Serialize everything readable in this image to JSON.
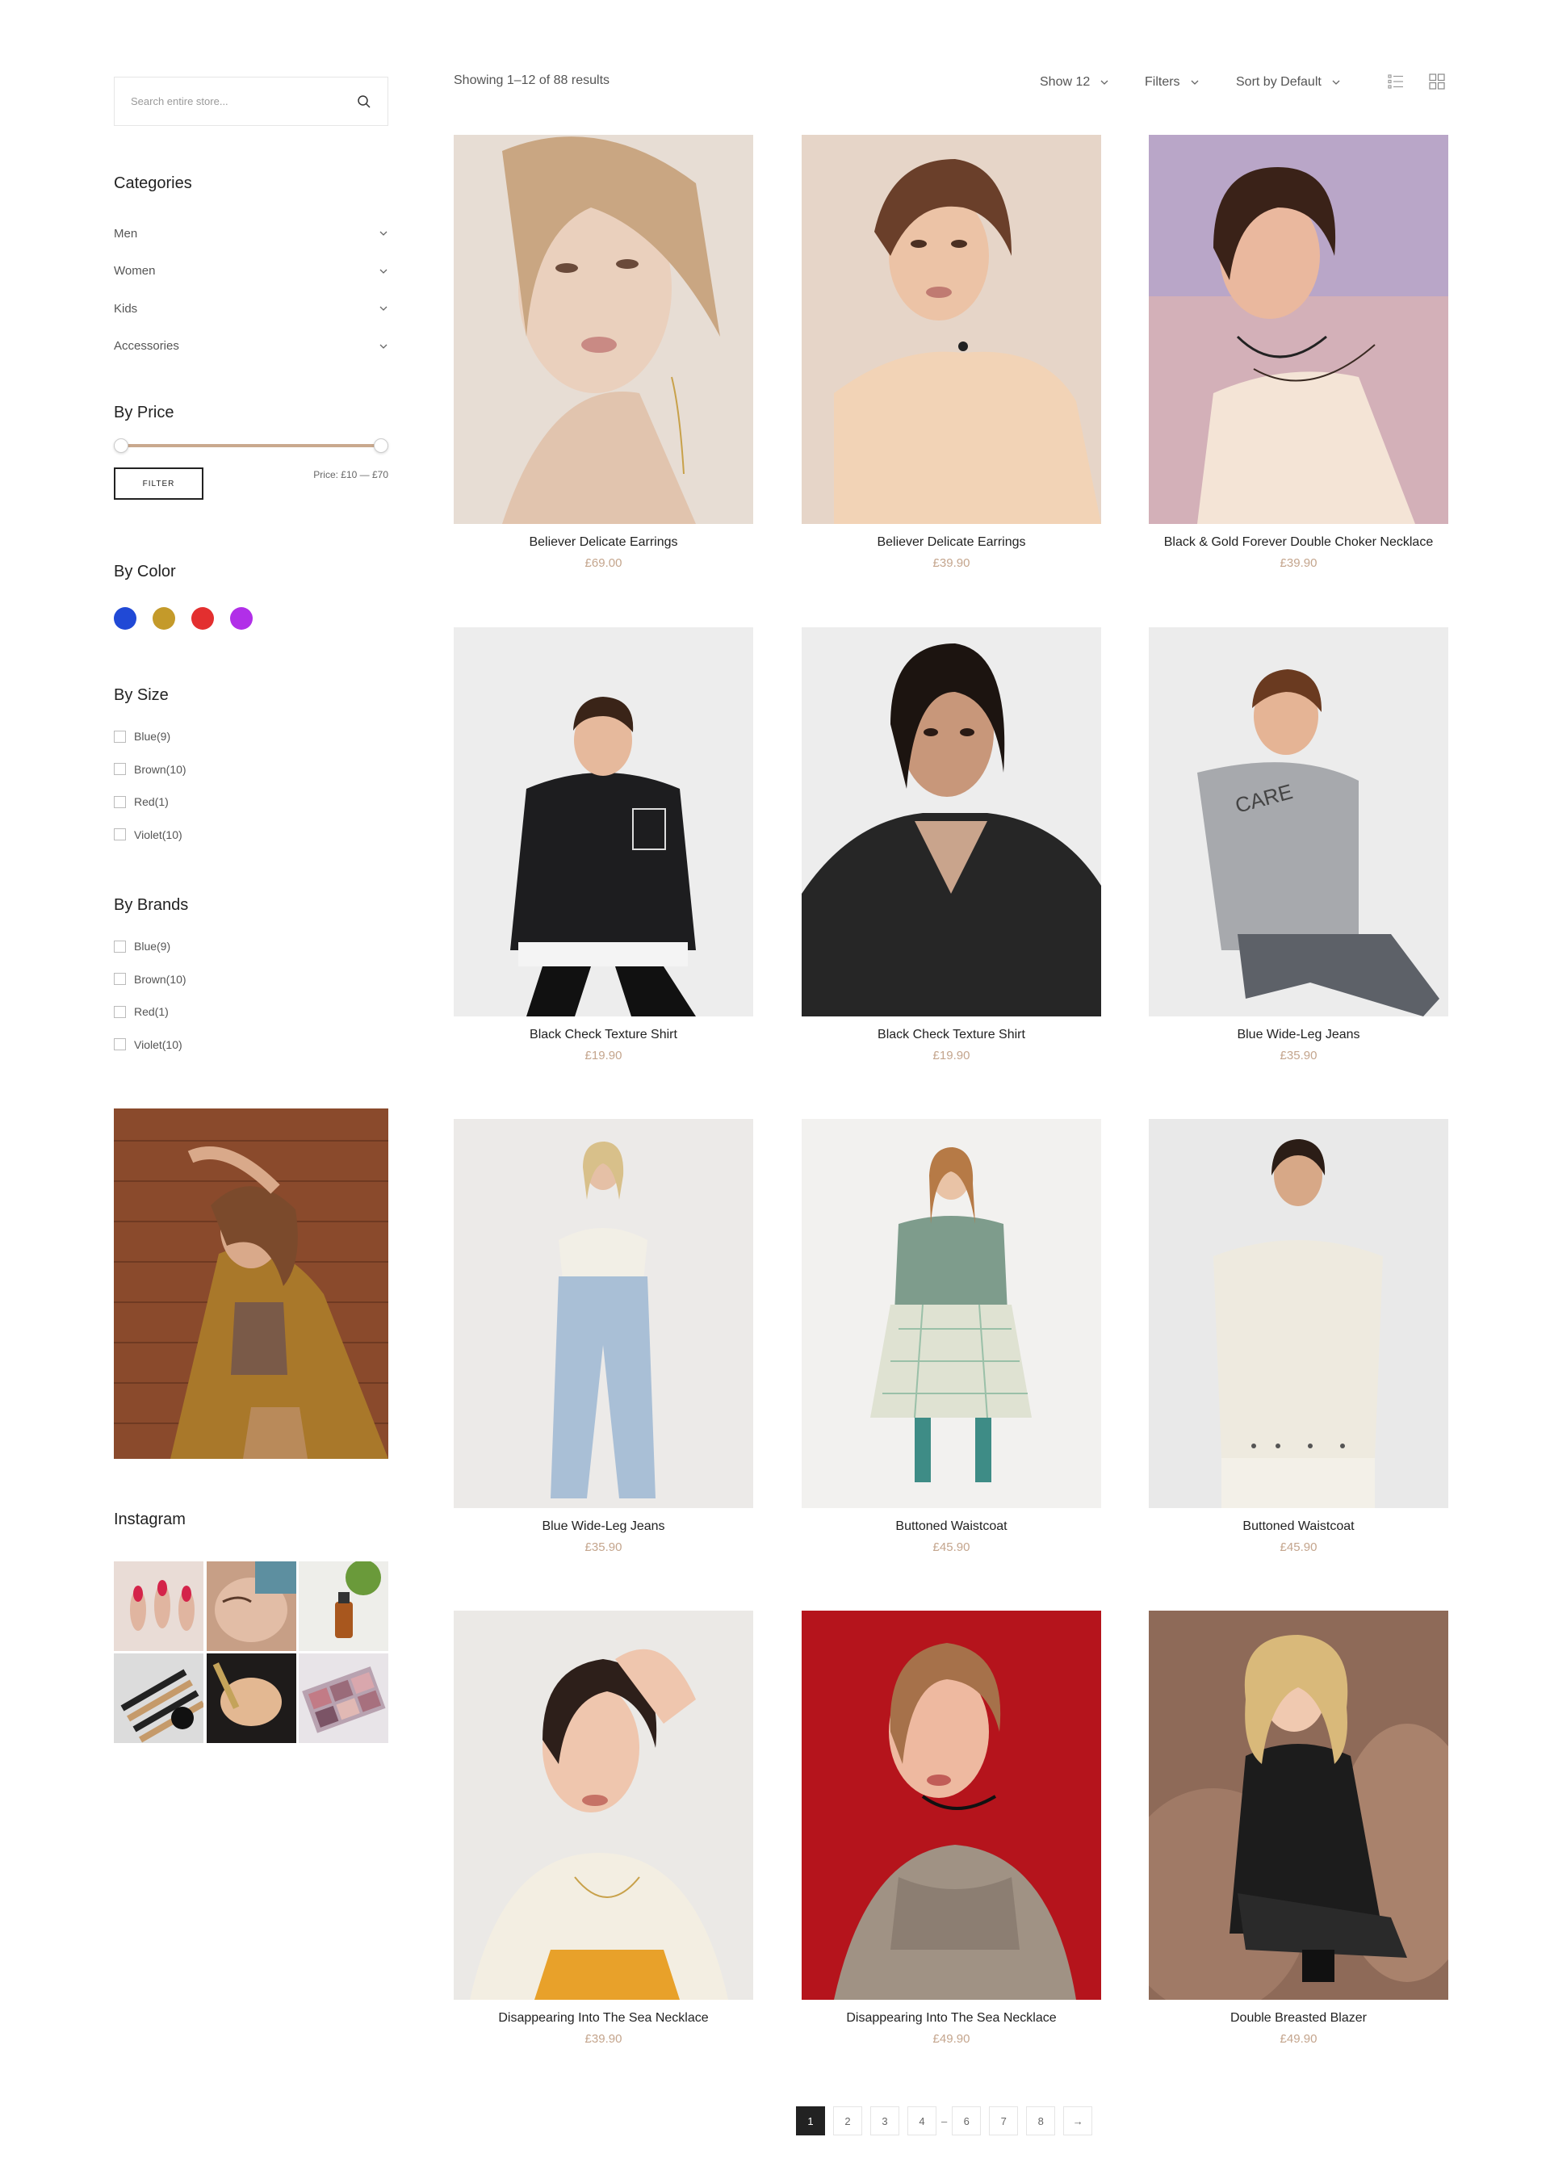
{
  "search": {
    "placeholder": "Search entire store..."
  },
  "categories": {
    "title": "Categories",
    "items": [
      {
        "label": "Men"
      },
      {
        "label": "Women"
      },
      {
        "label": "Kids"
      },
      {
        "label": "Accessories"
      }
    ]
  },
  "price": {
    "title": "By Price",
    "filter_label": "FILTER",
    "range_text": "Price: £10 — £70",
    "min_fraction": 0.0,
    "max_fraction": 1.0
  },
  "color": {
    "title": "By Color",
    "swatches": [
      "#2049d6",
      "#c49a2a",
      "#e32f2f",
      "#b12fe8"
    ]
  },
  "size": {
    "title": "By Size",
    "items": [
      {
        "label": "Blue(9)"
      },
      {
        "label": "Brown(10)"
      },
      {
        "label": "Red(1)"
      },
      {
        "label": "Violet(10)"
      }
    ]
  },
  "brands": {
    "title": "By Brands",
    "items": [
      {
        "label": "Blue(9)"
      },
      {
        "label": "Brown(10)"
      },
      {
        "label": "Red(1)"
      },
      {
        "label": "Violet(10)"
      }
    ]
  },
  "instagram": {
    "title": "Instagram"
  },
  "toolbar": {
    "result_count": "Showing 1–12 of 88 results",
    "show_label": "Show 12",
    "filters_label": "Filters",
    "sort_label": "Sort by Default"
  },
  "products": [
    {
      "name": "Believer Delicate Earrings",
      "price": "£69.00"
    },
    {
      "name": "Believer Delicate Earrings",
      "price": "£39.90"
    },
    {
      "name": "Black & Gold Forever Double Choker Necklace",
      "price": "£39.90"
    },
    {
      "name": "Black Check Texture Shirt",
      "price": "£19.90"
    },
    {
      "name": "Black Check Texture Shirt",
      "price": "£19.90"
    },
    {
      "name": "Blue Wide-Leg Jeans",
      "price": "£35.90"
    },
    {
      "name": "Blue Wide-Leg Jeans",
      "price": "£35.90"
    },
    {
      "name": "Buttoned Waistcoat",
      "price": "£45.90"
    },
    {
      "name": "Buttoned Waistcoat",
      "price": "£45.90"
    },
    {
      "name": "Disappearing Into The Sea Necklace",
      "price": "£39.90"
    },
    {
      "name": "Disappearing Into The Sea Necklace",
      "price": "£49.90"
    },
    {
      "name": "Double Breasted Blazer",
      "price": "£49.90"
    }
  ],
  "pagination": {
    "pages": [
      "1",
      "2",
      "3",
      "4",
      "6",
      "7",
      "8"
    ],
    "active": "1",
    "separator": "–",
    "next": "→"
  }
}
